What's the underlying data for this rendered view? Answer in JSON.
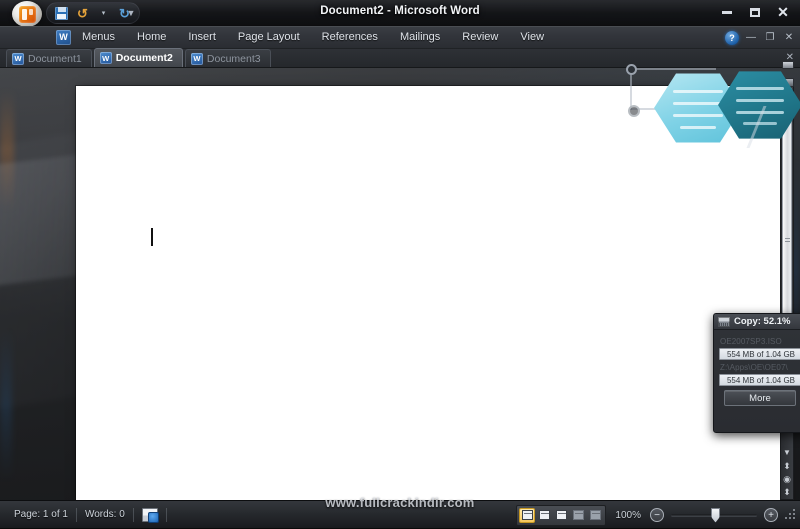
{
  "window": {
    "title": "Document2 - Microsoft Word",
    "minimize_label": "",
    "maximize_label": "",
    "close_label": "✕"
  },
  "quick_access": {
    "office_button": "office-orb",
    "items": [
      {
        "name": "save",
        "label": ""
      },
      {
        "name": "undo",
        "label": "↺"
      },
      {
        "name": "undo-dropdown",
        "label": "▾"
      },
      {
        "name": "redo",
        "label": "↻"
      }
    ],
    "customize_label": "▼"
  },
  "ribbon": {
    "tabs": [
      {
        "label": "Menus",
        "active": false
      },
      {
        "label": "Home",
        "active": false
      },
      {
        "label": "Insert",
        "active": false
      },
      {
        "label": "Page Layout",
        "active": false
      },
      {
        "label": "References",
        "active": false
      },
      {
        "label": "Mailings",
        "active": false
      },
      {
        "label": "Review",
        "active": false
      },
      {
        "label": "View",
        "active": false
      }
    ],
    "help_label": "?",
    "minimize_label": "—",
    "restore_label": "❐",
    "close_label": "✕",
    "word_icon": "W"
  },
  "document_tabs": {
    "items": [
      {
        "label": "Document1",
        "active": false
      },
      {
        "label": "Document2",
        "active": true
      },
      {
        "label": "Document3",
        "active": false
      }
    ],
    "close_label": "✕",
    "icon_letter": "W"
  },
  "document": {
    "page_background": "#ffffff",
    "caret_visible": true
  },
  "copy_dialog": {
    "title": "Copy: 52.1%",
    "icon": "copy-drive-icon",
    "items": [
      {
        "file": "OE2007SP3.ISO",
        "progress_label": "554 MB of 1.04 GB",
        "percent": 52.1
      },
      {
        "file": "Z:\\Apps\\OE\\OE07\\",
        "progress_label": "554 MB of 1.04 GB",
        "percent": 52.1
      }
    ],
    "more_button": "More"
  },
  "status_bar": {
    "page_label": "Page: 1 of 1",
    "words_label": "Words: 0",
    "proofing_icon": "proofing-errors-icon",
    "zoom_level": "100%",
    "zoom_out_label": "−",
    "zoom_in_label": "+",
    "view_buttons": [
      {
        "name": "print-layout",
        "active": true
      },
      {
        "name": "full-screen-reading",
        "active": false
      },
      {
        "name": "web-layout",
        "active": false
      },
      {
        "name": "outline",
        "active": false
      },
      {
        "name": "draft",
        "active": false
      }
    ]
  },
  "watermark": {
    "text": "www.fullcrackindir.com"
  },
  "colors": {
    "accent_blue": "#2a6fb5",
    "office_orange": "#e8760f",
    "hex_light": "#9fdcea",
    "hex_dark": "#2a8496",
    "active_tab": "#ffffff"
  }
}
